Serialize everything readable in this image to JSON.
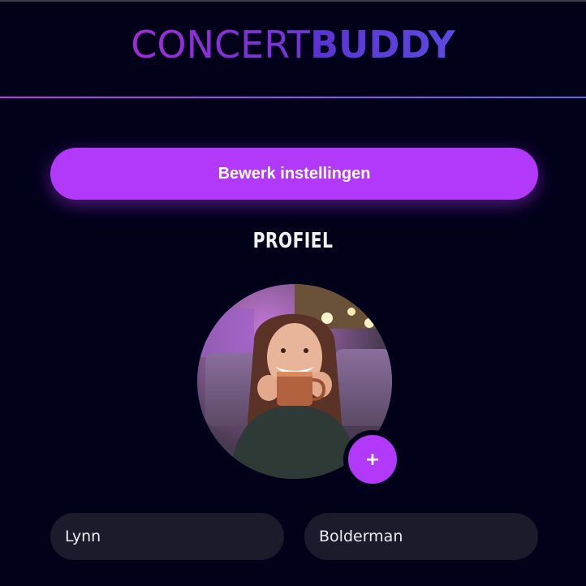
{
  "app": {
    "logo_light": "CONCERT",
    "logo_bold": "BUDDY"
  },
  "actions": {
    "settings_label": "Bewerk instellingen",
    "add_photo_label": "+"
  },
  "profile": {
    "title": "PROFIEL",
    "first_name": "Lynn",
    "last_name": "Bolderman"
  },
  "colors": {
    "background": "#02011a",
    "accent": "#b339fa",
    "field_background": "#1c1b2b",
    "logo_gradient_start": "#a22cd6",
    "logo_gradient_end": "#5d49e0"
  },
  "icons": {
    "add_photo": "plus-icon"
  }
}
